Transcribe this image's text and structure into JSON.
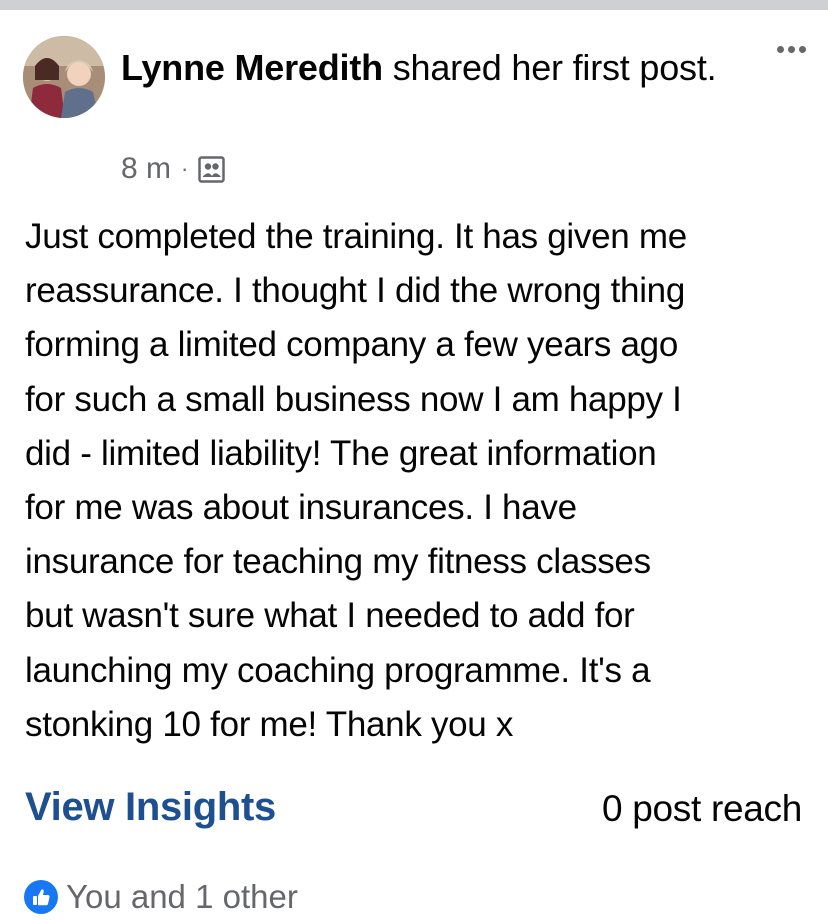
{
  "post": {
    "author": "Lynne Meredith",
    "action": " shared her first post.",
    "timestamp": "8 m",
    "separator": "·",
    "audience_icon": "group-audience-icon",
    "more_icon": "more-options-icon",
    "body": "Just completed the training. It has given me\nreassurance.  I thought I did the wrong thing\nforming a limited company a few years ago\nfor such a small business now I am happy I\ndid - limited liability!  The great information\nfor me was about insurances.  I have\ninsurance for teaching my fitness classes\nbut wasn't sure what I needed to add for\nlaunching my coaching programme.  It's a\nstonking 10 for me!  Thank you x",
    "view_insights_label": "View Insights",
    "reach": "0 post reach",
    "reactions": {
      "icon": "like-icon",
      "text": "You and 1 other"
    }
  },
  "colors": {
    "link": "#1d4f91",
    "secondary_text": "#65676b",
    "like_blue": "#1877f2",
    "divider": "#ced0d4"
  }
}
